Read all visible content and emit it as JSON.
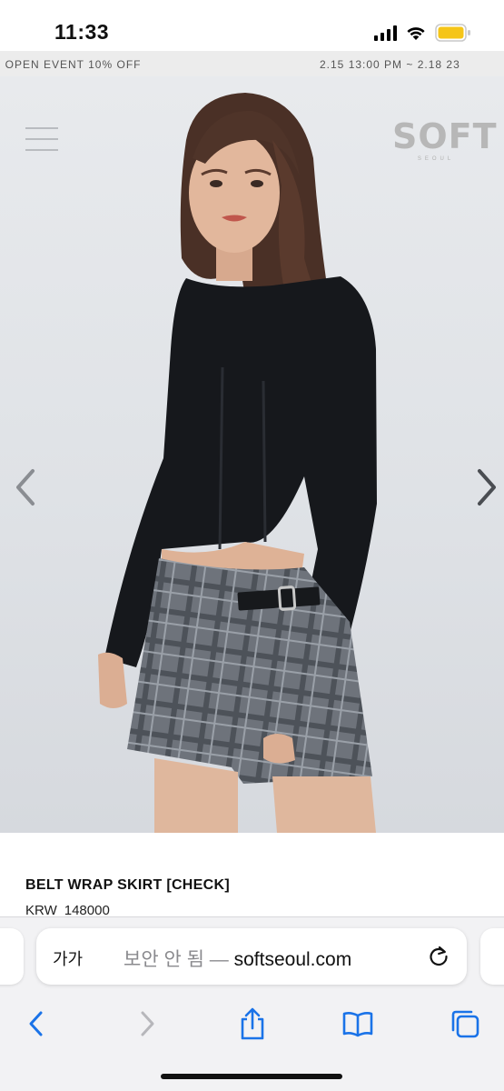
{
  "status_bar": {
    "time": "11:33",
    "icons": [
      "cellular-signal-icon",
      "wifi-icon",
      "battery-icon"
    ],
    "battery_color": "#f5c518"
  },
  "banner": {
    "left_text": "/) OPEN EVENT 10% OFF",
    "right_text": "2.15 13:00 PM ~ 2.18 23"
  },
  "hero": {
    "menu_icon": "hamburger-menu-icon",
    "logo_main": "SOFT",
    "logo_sub": "SEOUL",
    "prev_icon": "chevron-left-icon",
    "next_icon": "chevron-right-icon"
  },
  "product": {
    "name": "BELT WRAP SKIRT [CHECK]",
    "currency": "KRW",
    "price": "148000"
  },
  "address_bar": {
    "aa_label": "가가",
    "insecure_label": "보안 안 됨",
    "separator": " — ",
    "domain": "softseoul.com",
    "reload_icon": "reload-icon"
  },
  "toolbar": {
    "items": [
      "back-icon",
      "forward-icon",
      "share-icon",
      "bookmarks-icon",
      "tabs-icon"
    ],
    "accent": "#1a73e8",
    "disabled": "#b7b7bb"
  }
}
